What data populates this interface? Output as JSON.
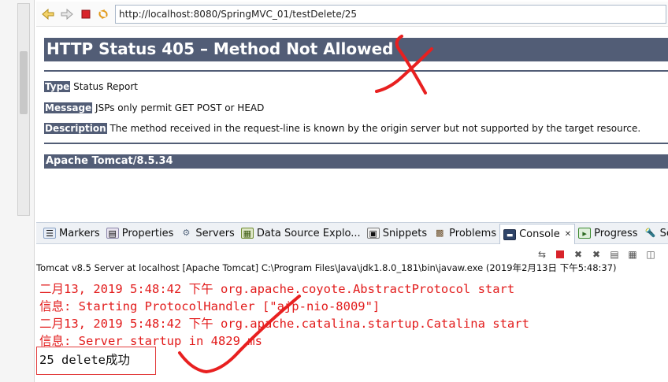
{
  "browser": {
    "url": "http://localhost:8080/SpringMVC_01/testDelete/25",
    "icons": [
      "back-icon",
      "forward-icon",
      "stop-icon",
      "refresh-icon"
    ]
  },
  "error_page": {
    "title": "HTTP Status 405 – Method Not Allowed",
    "type_label": "Type",
    "type_value": "Status Report",
    "message_label": "Message",
    "message_value": "JSPs only permit GET POST or HEAD",
    "description_label": "Description",
    "description_value": "The method received in the request-line is known by the origin server but not supported by the target resource.",
    "server": "Apache Tomcat/8.5.34",
    "header_color": "#525d76"
  },
  "tabs": [
    {
      "label": "Markers",
      "icon": "markers-icon",
      "active": false
    },
    {
      "label": "Properties",
      "icon": "properties-icon",
      "active": false
    },
    {
      "label": "Servers",
      "icon": "servers-icon",
      "active": false
    },
    {
      "label": "Data Source Explo...",
      "icon": "data-source-icon",
      "active": false
    },
    {
      "label": "Snippets",
      "icon": "snippets-icon",
      "active": false
    },
    {
      "label": "Problems",
      "icon": "problems-icon",
      "active": false
    },
    {
      "label": "Console",
      "icon": "console-icon",
      "active": true
    },
    {
      "label": "Progress",
      "icon": "progress-icon",
      "active": false
    },
    {
      "label": "Search",
      "icon": "search-icon",
      "active": false
    }
  ],
  "console": {
    "header": "Tomcat v8.5 Server at localhost [Apache Tomcat] C:\\Program Files\\Java\\jdk1.8.0_181\\bin\\javaw.exe (2019年2月13日 下午5:48:37)",
    "lines": [
      "二月13, 2019 5:48:42 下午 org.apache.coyote.AbstractProtocol start",
      "信息: Starting ProtocolHandler [\"ajp-nio-8009\"]",
      "二月13, 2019 5:48:42 下午 org.apache.catalina.startup.Catalina start",
      "信息: Server startup in 4829 ms"
    ],
    "result_line": "25 delete成功",
    "output_color": "#e21b1b"
  }
}
